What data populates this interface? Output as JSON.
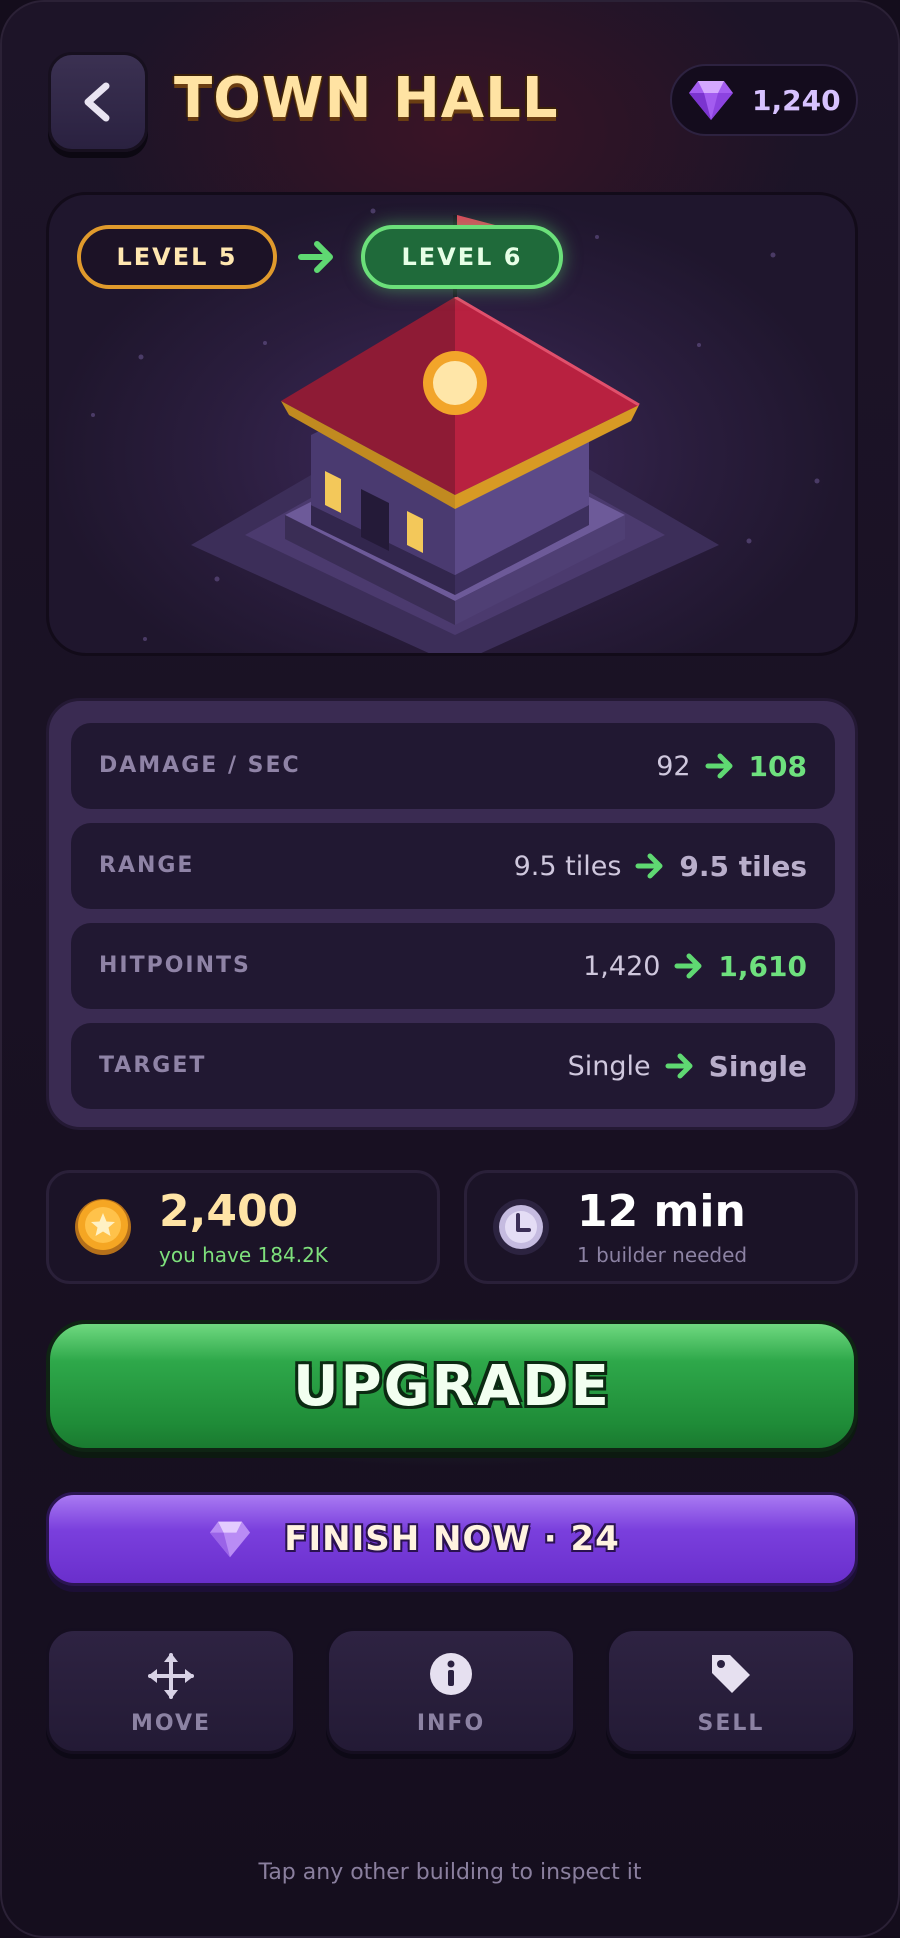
{
  "header": {
    "title": "TOWN HALL",
    "gems": "1,240"
  },
  "hero": {
    "current_level": "LEVEL 5",
    "next_level": "LEVEL 6"
  },
  "stats": [
    {
      "label": "DAMAGE / SEC",
      "current": "92",
      "next": "108",
      "changed": true
    },
    {
      "label": "RANGE",
      "current": "9.5 tiles",
      "next": "9.5 tiles",
      "changed": false
    },
    {
      "label": "HITPOINTS",
      "current": "1,420",
      "next": "1,610",
      "changed": true
    },
    {
      "label": "TARGET",
      "current": "Single",
      "next": "Single",
      "changed": false
    }
  ],
  "cost": {
    "gold": {
      "amount": "2,400",
      "sub": "you have 184.2K",
      "icon": "gold-coin-icon"
    },
    "time": {
      "amount": "12 min",
      "sub": "1 builder needed",
      "icon": "clock-icon"
    }
  },
  "buttons": {
    "upgrade": "UPGRADE",
    "finish_now": "FINISH NOW  ·  24",
    "move": "MOVE",
    "info": "INFO",
    "sell": "SELL"
  },
  "footer": {
    "hint": "Tap any other building to inspect it"
  },
  "colors": {
    "accent_green": "#6ee07e",
    "accent_purple": "#7a3fdd",
    "gold": "#ffe4a6"
  }
}
